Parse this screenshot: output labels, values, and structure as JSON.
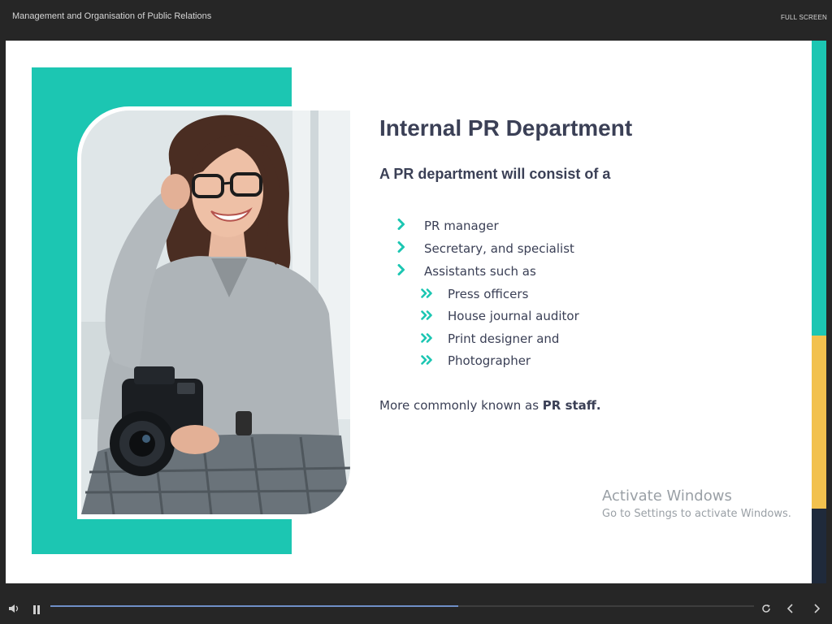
{
  "header": {
    "course_title": "Management and Organisation of Public Relations",
    "fullscreen_label": "FULL SCREEN"
  },
  "slide": {
    "heading": "Internal PR Department",
    "subheading": "A PR department will consist of a",
    "bullets": [
      {
        "level": 1,
        "text": "PR manager"
      },
      {
        "level": 1,
        "text": "Secretary, and specialist"
      },
      {
        "level": 1,
        "text": "Assistants such as"
      },
      {
        "level": 2,
        "text": "Press officers"
      },
      {
        "level": 2,
        "text": "House journal auditor"
      },
      {
        "level": 2,
        "text": "Print designer and"
      },
      {
        "level": 2,
        "text": "Photographer"
      }
    ],
    "closing_prefix": "More commonly known as ",
    "closing_bold": "PR staff.",
    "photo_subject": "smiling woman with glasses holding a camera"
  },
  "watermark": {
    "title": "Activate Windows",
    "subtitle": "Go to Settings to activate Windows."
  },
  "player": {
    "progress": 0.58
  },
  "icons": {
    "volume": "volume-icon",
    "pause": "pause-icon",
    "replay": "replay-icon",
    "previous": "chevron-left-icon",
    "next": "chevron-right-icon",
    "bullet_l1": "chevron-right-icon",
    "bullet_l2": "double-chevron-right-icon"
  },
  "colors": {
    "accent_teal": "#1cc6b2",
    "accent_yellow": "#f2c14e",
    "accent_navy": "#1f2a3b",
    "text_dark": "#3b4056",
    "player_bg": "#262626",
    "progress_fill": "#6f8fc7"
  }
}
